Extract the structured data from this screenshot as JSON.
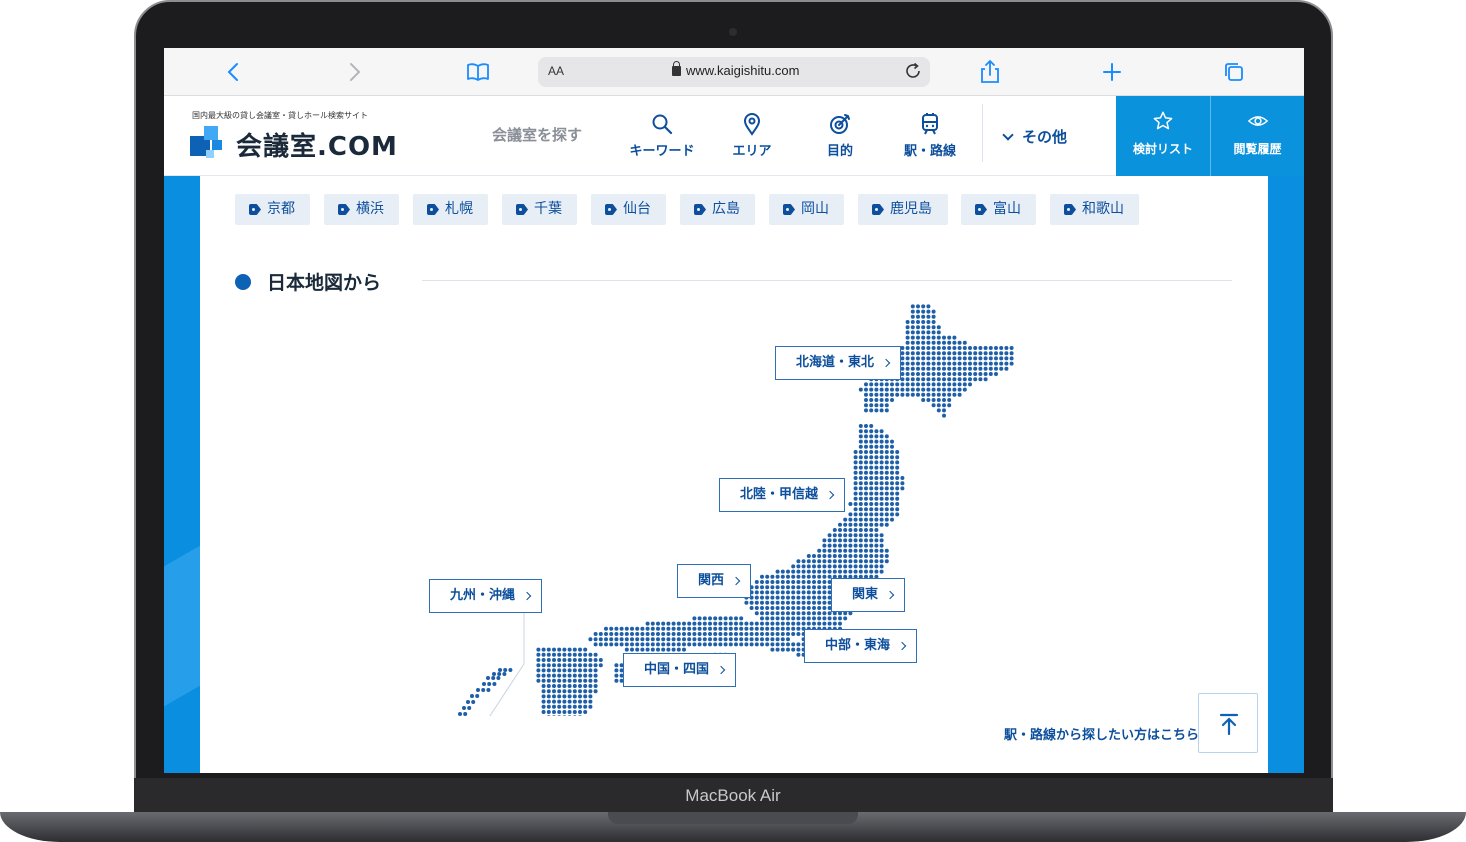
{
  "device": {
    "brand": "MacBook Air"
  },
  "browser": {
    "text_size_label": "AA",
    "url": "www.kaigishitu.com",
    "icons": [
      "back-icon",
      "forward-icon",
      "bookmarks-icon",
      "lock-icon",
      "reload-icon",
      "share-icon",
      "new-tab-icon",
      "tabs-icon"
    ]
  },
  "site": {
    "tagline": "国内最大級の貸し会議室・貸しホール検索サイト",
    "logo_text": "会議室.COM",
    "search_label": "会議室を探す",
    "nav": [
      {
        "label": "キーワード",
        "icon": "search-icon"
      },
      {
        "label": "エリア",
        "icon": "map-pin-icon"
      },
      {
        "label": "目的",
        "icon": "target-icon"
      },
      {
        "label": "駅・路線",
        "icon": "train-icon"
      }
    ],
    "other_label": "その他",
    "wishlist_label": "検討リスト",
    "history_label": "閲覧履歴"
  },
  "city_tags": [
    "京都",
    "横浜",
    "札幌",
    "千葉",
    "仙台",
    "広島",
    "岡山",
    "鹿児島",
    "富山",
    "和歌山"
  ],
  "section": {
    "title": "日本地図から"
  },
  "regions": [
    {
      "label": "北海道・東北"
    },
    {
      "label": "北陸・甲信越"
    },
    {
      "label": "関西"
    },
    {
      "label": "関東"
    },
    {
      "label": "九州・沖縄"
    },
    {
      "label": "中部・東海"
    },
    {
      "label": "中国・四国"
    }
  ],
  "station_link": "駅・路線から探したい方はこちら",
  "colors": {
    "accent": "#0a92dd",
    "brand_dark": "#0d4f9c",
    "map_dot": "#1f5fa8"
  }
}
